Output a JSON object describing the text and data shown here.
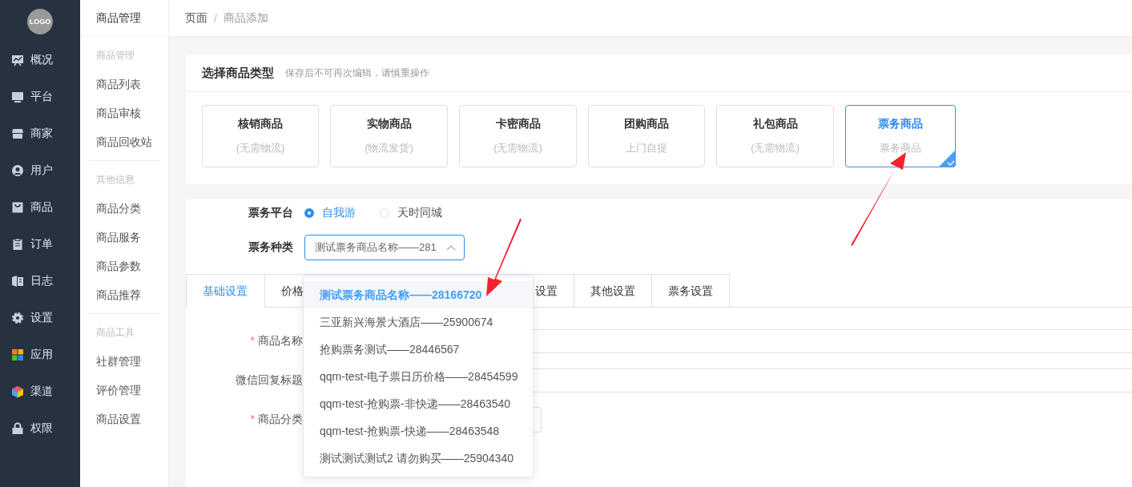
{
  "logo": "LOGO",
  "nav": [
    {
      "label": "概况"
    },
    {
      "label": "平台"
    },
    {
      "label": "商家"
    },
    {
      "label": "用户"
    },
    {
      "label": "商品"
    },
    {
      "label": "订单"
    },
    {
      "label": "日志"
    },
    {
      "label": "设置"
    },
    {
      "label": "应用"
    },
    {
      "label": "渠道"
    },
    {
      "label": "权限"
    }
  ],
  "subnav": {
    "title": "商品管理",
    "groups": [
      {
        "heading": "商品管理",
        "items": [
          "商品列表",
          "商品审核",
          "商品回收站"
        ]
      },
      {
        "heading": "其他信息",
        "items": [
          "商品分类",
          "商品服务",
          "商品参数",
          "商品推荐"
        ]
      },
      {
        "heading": "商品工具",
        "items": [
          "社群管理",
          "评价管理",
          "商品设置"
        ]
      }
    ]
  },
  "breadcrumb": {
    "items": [
      "页面",
      "商品添加"
    ],
    "separator": "/"
  },
  "type_card": {
    "title": "选择商品类型",
    "hint": "保存后不可再次编辑，请慎重操作",
    "types": [
      {
        "name": "核销商品",
        "note": "(无需物流)",
        "selected": false
      },
      {
        "name": "实物商品",
        "note": "(物流发货)",
        "selected": false
      },
      {
        "name": "卡密商品",
        "note": "(无需物流)",
        "selected": false
      },
      {
        "name": "团购商品",
        "note": "上门自提",
        "selected": false
      },
      {
        "name": "礼包商品",
        "note": "(无需物流)",
        "selected": false
      },
      {
        "name": "票务商品",
        "note": "票务商品",
        "selected": true
      }
    ]
  },
  "platform": {
    "label": "票务平台",
    "options": [
      {
        "label": "自我游",
        "selected": true
      },
      {
        "label": "天时同城",
        "selected": false
      }
    ]
  },
  "ticket_kind": {
    "label": "票务种类",
    "value": "测试票务商品名称——281",
    "expanded": true,
    "options": [
      {
        "label": "测试票务商品名称——28166720",
        "selected": true
      },
      {
        "label": "三亚新兴海景大酒店——25900674",
        "selected": false
      },
      {
        "label": "抢购票务测试——28446567",
        "selected": false
      },
      {
        "label": "qqm-test-电子票日历价格——28454599",
        "selected": false
      },
      {
        "label": "qqm-test-抢购票-非快递——28463540",
        "selected": false
      },
      {
        "label": "qqm-test-抢购票-快递——28463548",
        "selected": false
      },
      {
        "label": "测试测试测试2 请勿购买——25904340",
        "selected": false
      }
    ]
  },
  "tabs": [
    {
      "label": "基础设置",
      "selected": true
    },
    {
      "label": "价格",
      "selected": false
    },
    {
      "label": "设置",
      "selected": false
    },
    {
      "label": "其他设置",
      "selected": false
    },
    {
      "label": "票务设置",
      "selected": false
    }
  ],
  "fields": [
    {
      "label": "商品名称",
      "marker": "*",
      "kind": "input"
    },
    {
      "label": "微信回复标题",
      "kind": "input"
    },
    {
      "label": "商品分类",
      "marker": "*",
      "kind": "select"
    }
  ]
}
